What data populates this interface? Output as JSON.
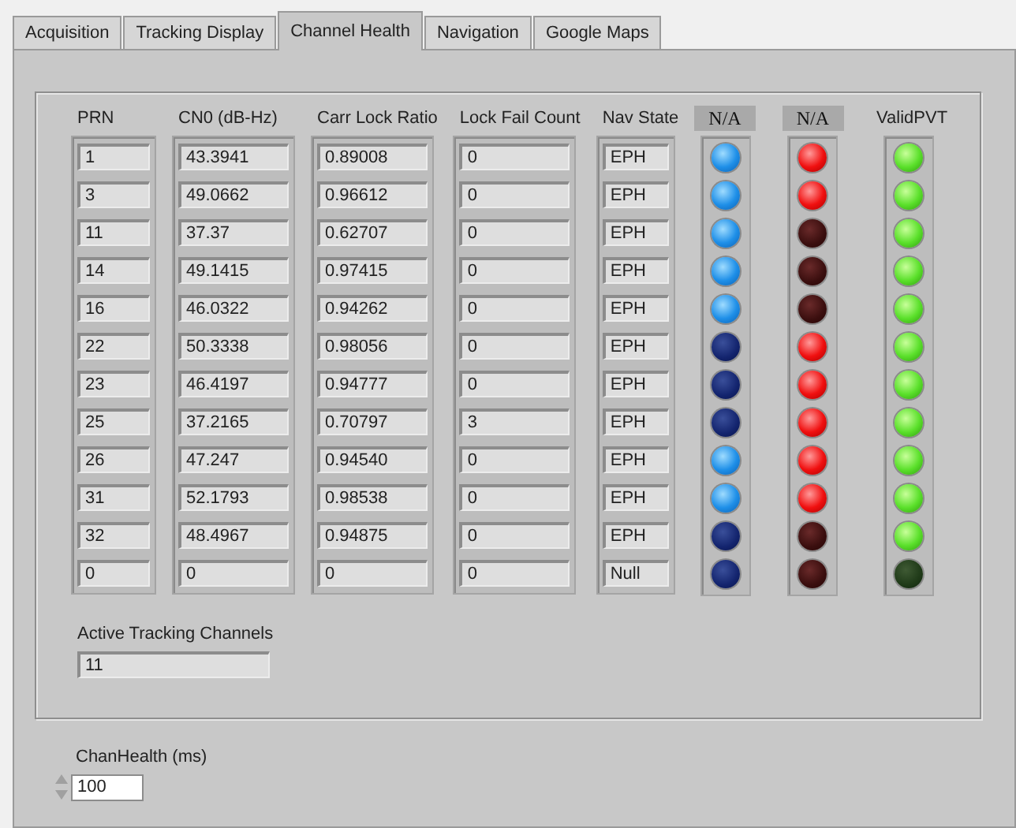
{
  "tabs": [
    {
      "label": "Acquisition",
      "selected": false
    },
    {
      "label": "Tracking Display",
      "selected": false
    },
    {
      "label": "Channel Health",
      "selected": true
    },
    {
      "label": "Navigation",
      "selected": false
    },
    {
      "label": "Google Maps",
      "selected": false
    }
  ],
  "arrays": [
    {
      "label": "PRN",
      "values": [
        "1",
        "3",
        "11",
        "14",
        "16",
        "22",
        "23",
        "25",
        "26",
        "31",
        "32",
        "0"
      ]
    },
    {
      "label": "CN0 (dB-Hz)",
      "values": [
        "43.3941",
        "49.0662",
        "37.37",
        "49.1415",
        "46.0322",
        "50.3338",
        "46.4197",
        "37.2165",
        "47.247",
        "52.1793",
        "48.4967",
        "0"
      ]
    },
    {
      "label": "Carr Lock Ratio",
      "values": [
        "0.89008",
        "0.96612",
        "0.62707",
        "0.97415",
        "0.94262",
        "0.98056",
        "0.94777",
        "0.70797",
        "0.94540",
        "0.98538",
        "0.94875",
        "0"
      ]
    },
    {
      "label": "Lock Fail Count",
      "values": [
        "0",
        "0",
        "0",
        "0",
        "0",
        "0",
        "0",
        "3",
        "0",
        "0",
        "0",
        "0"
      ]
    },
    {
      "label": "Nav State",
      "values": [
        "EPH",
        "EPH",
        "EPH",
        "EPH",
        "EPH",
        "EPH",
        "EPH",
        "EPH",
        "EPH",
        "EPH",
        "EPH",
        "Null"
      ]
    }
  ],
  "led_arrays": [
    {
      "label": "N/A",
      "label_boxed": true,
      "kind": "blue",
      "leds": [
        {
          "on": true
        },
        {
          "on": true
        },
        {
          "on": true
        },
        {
          "on": true
        },
        {
          "on": true
        },
        {
          "on": false
        },
        {
          "on": false
        },
        {
          "on": false
        },
        {
          "on": true
        },
        {
          "on": true
        },
        {
          "on": false
        },
        {
          "on": false
        }
      ]
    },
    {
      "label": "N/A",
      "label_boxed": true,
      "kind": "red",
      "leds": [
        {
          "on": true
        },
        {
          "on": true
        },
        {
          "on": false
        },
        {
          "on": false
        },
        {
          "on": false
        },
        {
          "on": true
        },
        {
          "on": true
        },
        {
          "on": true
        },
        {
          "on": true
        },
        {
          "on": true
        },
        {
          "on": false
        },
        {
          "on": false
        }
      ]
    },
    {
      "label": "ValidPVT",
      "label_boxed": false,
      "kind": "green",
      "leds": [
        {
          "on": true
        },
        {
          "on": true
        },
        {
          "on": true
        },
        {
          "on": true
        },
        {
          "on": true
        },
        {
          "on": true
        },
        {
          "on": true
        },
        {
          "on": true
        },
        {
          "on": true
        },
        {
          "on": true
        },
        {
          "on": true
        },
        {
          "on": false
        }
      ]
    }
  ],
  "active_tracking": {
    "label": "Active Tracking Channels",
    "value": "11"
  },
  "chan_health": {
    "label": "ChanHealth (ms)",
    "value": "100"
  }
}
